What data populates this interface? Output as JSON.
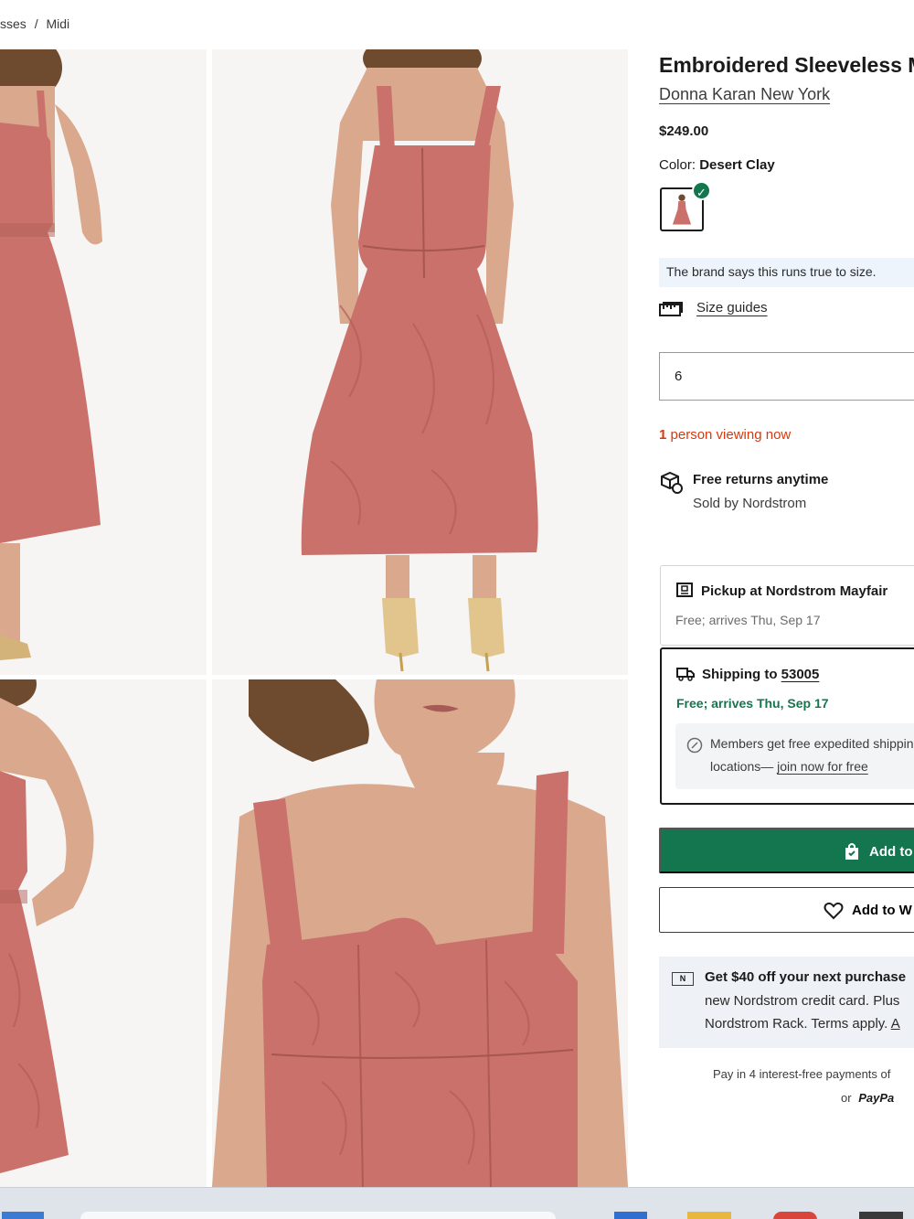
{
  "breadcrumb": {
    "items": [
      "sses",
      "/",
      "Midi"
    ]
  },
  "product": {
    "title": "Embroidered Sleeveless M",
    "brand": "Donna Karan New York",
    "price": "$249.00",
    "color_label": "Color:",
    "color_value": "Desert Clay",
    "selected_swatch_check": "✓",
    "fit_note": "The brand says this runs true to size.",
    "size_guides_label": "Size guides",
    "size_value": "6",
    "viewing_count": "1",
    "viewing_text": "person viewing now",
    "returns_title": "Free returns anytime",
    "returns_sub": "Sold by Nordstrom"
  },
  "fulfillment": {
    "pickup_label": "Pickup at Nordstrom Mayfair",
    "pickup_detail": "Free; arrives Thu, Sep 17",
    "shipping_prefix": "Shipping to",
    "shipping_zip": "53005",
    "shipping_detail": "Free; arrives Thu, Sep 17",
    "members_line1": "Members get free expedited shippin",
    "members_line2_prefix": "locations—",
    "members_link": "join now for free"
  },
  "actions": {
    "add_to_bag": "Add to",
    "add_to_wishlist": "Add to W"
  },
  "promo": {
    "icon_letter": "N",
    "line1": "Get $40 off your next purchase",
    "line2": "new Nordstrom credit card. Plus",
    "line3_prefix": "Nordstrom Rack. Terms apply.",
    "line3_link": "A"
  },
  "payments": {
    "line1": "Pay in 4 interest-free payments of",
    "or": "or",
    "paypal": "PayPa"
  },
  "colors": {
    "dress": "#c9716a",
    "dress_dark": "#b4605a",
    "skin": "#d9a88d",
    "hair": "#6e4a2f",
    "green": "#14764e",
    "alert": "#d6390e",
    "note_bg": "#eef4fb"
  },
  "icons": [
    "size-guide-icon",
    "returns-box-icon",
    "store-icon",
    "truck-icon",
    "membership-icon",
    "shopping-bag-icon",
    "heart-icon",
    "nordstrom-card-icon",
    "paypal-icon"
  ]
}
